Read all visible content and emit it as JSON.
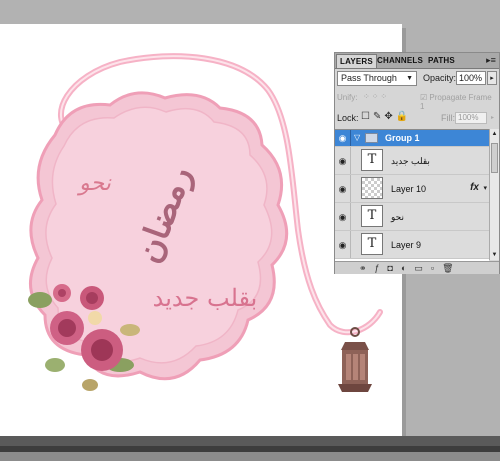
{
  "artwork": {
    "text_top": "نحو",
    "text_middle": "رمضان",
    "text_bottom": "بقلب جديد"
  },
  "panel": {
    "tabs": [
      "LAYERS",
      "CHANNELS",
      "PATHS"
    ],
    "menu_icon": "panel-menu-icon",
    "blend_mode": "Pass Through",
    "opacity_label": "Opacity:",
    "opacity_value": "100%",
    "unify_label": "Unify:",
    "propagate_label": "Propagate Frame 1",
    "lock_label": "Lock:",
    "fill_label": "Fill:",
    "fill_value": "100%",
    "layers": [
      {
        "type": "group",
        "name": "Group 1"
      },
      {
        "type": "text",
        "name": "بقلب جديد",
        "thumb": "T"
      },
      {
        "type": "image",
        "name": "Layer 10",
        "fx": "fx"
      },
      {
        "type": "text",
        "name": "نحو",
        "thumb": "T"
      },
      {
        "type": "text",
        "name": "Layer 9",
        "thumb": "T"
      }
    ]
  },
  "colors": {
    "group_highlight": "#3d86d6",
    "badge_pink": "#f4c8d6",
    "ribbon_pink": "#f7b8cc",
    "text_pink": "#d8738f"
  }
}
